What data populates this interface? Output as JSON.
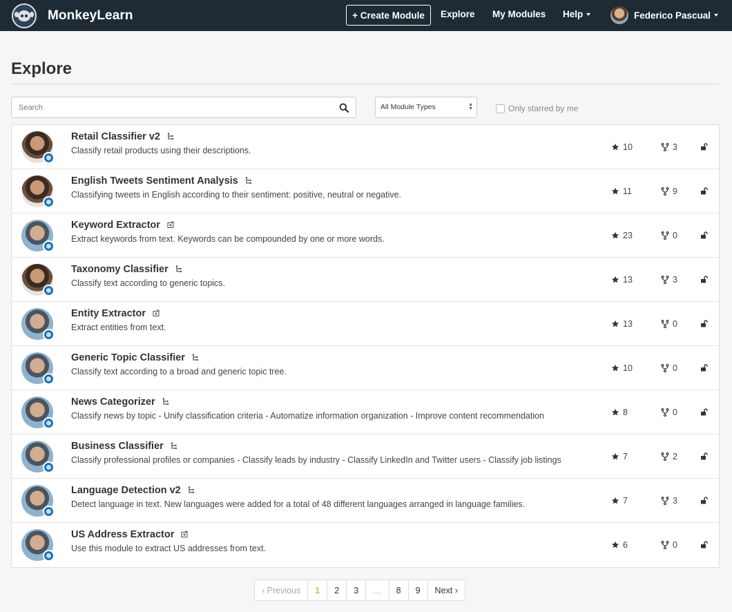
{
  "brand": {
    "name": "MonkeyLearn"
  },
  "nav": {
    "create_label": "+ Create Module",
    "explore_label": "Explore",
    "my_modules_label": "My Modules",
    "help_label": "Help",
    "user_name": "Federico Pascual"
  },
  "page": {
    "title": "Explore"
  },
  "filters": {
    "search_placeholder": "Search",
    "module_type": "All Module Types",
    "only_starred_label": "Only starred by me",
    "only_starred_checked": false
  },
  "modules": [
    {
      "title": "Retail Classifier v2",
      "type": "classifier",
      "description": "Classify retail products using their descriptions.",
      "stars": "10",
      "forks": "3",
      "avatar": "a"
    },
    {
      "title": "English Tweets Sentiment Analysis",
      "type": "classifier",
      "description": "Classifying tweets in English according to their sentiment: positive, neutral or negative.",
      "stars": "11",
      "forks": "9",
      "avatar": "a"
    },
    {
      "title": "Keyword Extractor",
      "type": "extractor",
      "description": "Extract keywords from text. Keywords can be compounded by one or more words.",
      "stars": "23",
      "forks": "0",
      "avatar": "b"
    },
    {
      "title": "Taxonomy Classifier",
      "type": "classifier",
      "description": "Classify text according to generic topics.",
      "stars": "13",
      "forks": "3",
      "avatar": "a"
    },
    {
      "title": "Entity Extractor",
      "type": "extractor",
      "description": "Extract entities from text.",
      "stars": "13",
      "forks": "0",
      "avatar": "b"
    },
    {
      "title": "Generic Topic Classifier",
      "type": "classifier",
      "description": "Classify text according to a broad and generic topic tree.",
      "stars": "10",
      "forks": "0",
      "avatar": "b"
    },
    {
      "title": "News Categorizer",
      "type": "classifier",
      "description": "Classify news by topic - Unify classification criteria - Automatize information organization - Improve content recommendation",
      "stars": "8",
      "forks": "0",
      "avatar": "b"
    },
    {
      "title": "Business Classifier",
      "type": "classifier",
      "description": "Classify professional profiles or companies - Classify leads by industry - Classify LinkedIn and Twitter users - Classify job listings",
      "stars": "7",
      "forks": "2",
      "avatar": "b"
    },
    {
      "title": "Language Detection v2",
      "type": "classifier",
      "description": "Detect language in text. New languages were added for a total of 48 different languages arranged in language families.",
      "stars": "7",
      "forks": "3",
      "avatar": "b"
    },
    {
      "title": "US Address Extractor",
      "type": "extractor",
      "description": "Use this module to extract US addresses from text.",
      "stars": "6",
      "forks": "0",
      "avatar": "b"
    }
  ],
  "pagination": {
    "previous_label": "‹ Previous",
    "pages": [
      "1",
      "2",
      "3",
      "…",
      "8",
      "9"
    ],
    "current": "1",
    "next_label": "Next ›"
  },
  "icons": {
    "star": "star-icon",
    "fork": "fork-icon",
    "lock": "unlock-icon",
    "classifier": "tree-icon",
    "extractor": "extract-icon"
  },
  "colors": {
    "navbar": "#1e2b34",
    "active_page": "#f5a65b",
    "badge": "#1f6fb0"
  }
}
